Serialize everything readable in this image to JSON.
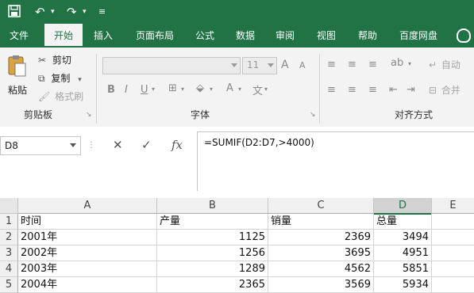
{
  "ribbon_tabs": [
    "文件",
    "开始",
    "插入",
    "页面布局",
    "公式",
    "数据",
    "审阅",
    "视图",
    "帮助",
    "百度网盘"
  ],
  "clipboard": {
    "paste": "粘贴",
    "cut": "剪切",
    "copy": "复制",
    "format_painter": "格式刷",
    "group_label": "剪贴板"
  },
  "font": {
    "name": "",
    "size": "11",
    "group_label": "字体"
  },
  "alignment": {
    "wrap": "自动",
    "merge": "合并",
    "group_label": "对齐方式"
  },
  "formula_bar": {
    "cell_ref": "D8",
    "formula": "=SUMIF(D2:D7,>4000)"
  },
  "columns": [
    "A",
    "B",
    "C",
    "D",
    "E"
  ],
  "rows": [
    {
      "num": "1",
      "cells": [
        "时间",
        "产量",
        "销量",
        "总量"
      ]
    },
    {
      "num": "2",
      "cells": [
        "2001年",
        "1125",
        "2369",
        "3494"
      ]
    },
    {
      "num": "3",
      "cells": [
        "2002年",
        "1256",
        "3695",
        "4951"
      ]
    },
    {
      "num": "4",
      "cells": [
        "2003年",
        "1289",
        "4562",
        "5851"
      ]
    },
    {
      "num": "5",
      "cells": [
        "2004年",
        "2365",
        "3569",
        "5934"
      ]
    }
  ],
  "colors": {
    "brand": "#217346",
    "ribbon_bg": "#f3f3f3"
  }
}
